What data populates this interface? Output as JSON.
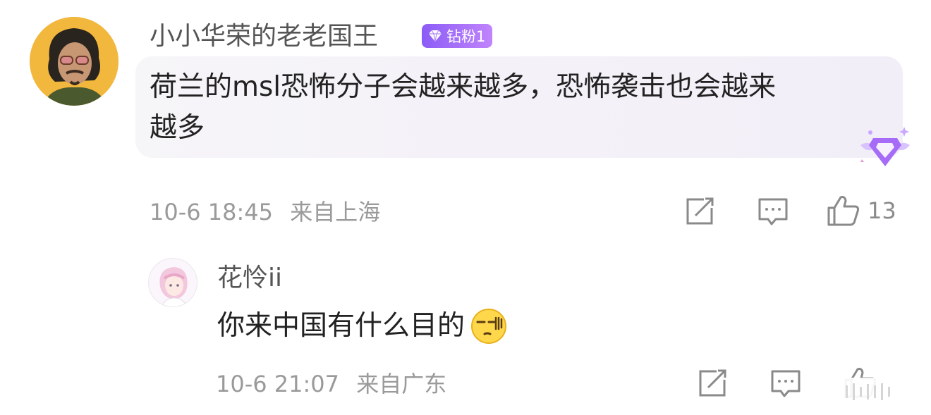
{
  "comment": {
    "username": "小小华荣的老老国王",
    "badge_label": "钻粉1",
    "text_line1": "荷兰的msl恐怖分子会越来越多，恐怖袭击也会越来",
    "text_line2": "越多",
    "timestamp": "10-6 18:45",
    "location": "来自上海",
    "like_count": "13"
  },
  "reply": {
    "username": "花怜ii",
    "text": "你来中国有什么目的",
    "timestamp": "10-6 21:07",
    "location": "来自广东"
  },
  "icons": {
    "share": "share-icon",
    "comment": "comment-icon",
    "like": "thumbs-up-icon",
    "badge": "diamond-icon",
    "emoji": "smirk-emoji-icon"
  },
  "colors": {
    "badge": "#a46cf7",
    "bubble": "#f4f2f7",
    "meta_text": "#9a9a9a"
  }
}
